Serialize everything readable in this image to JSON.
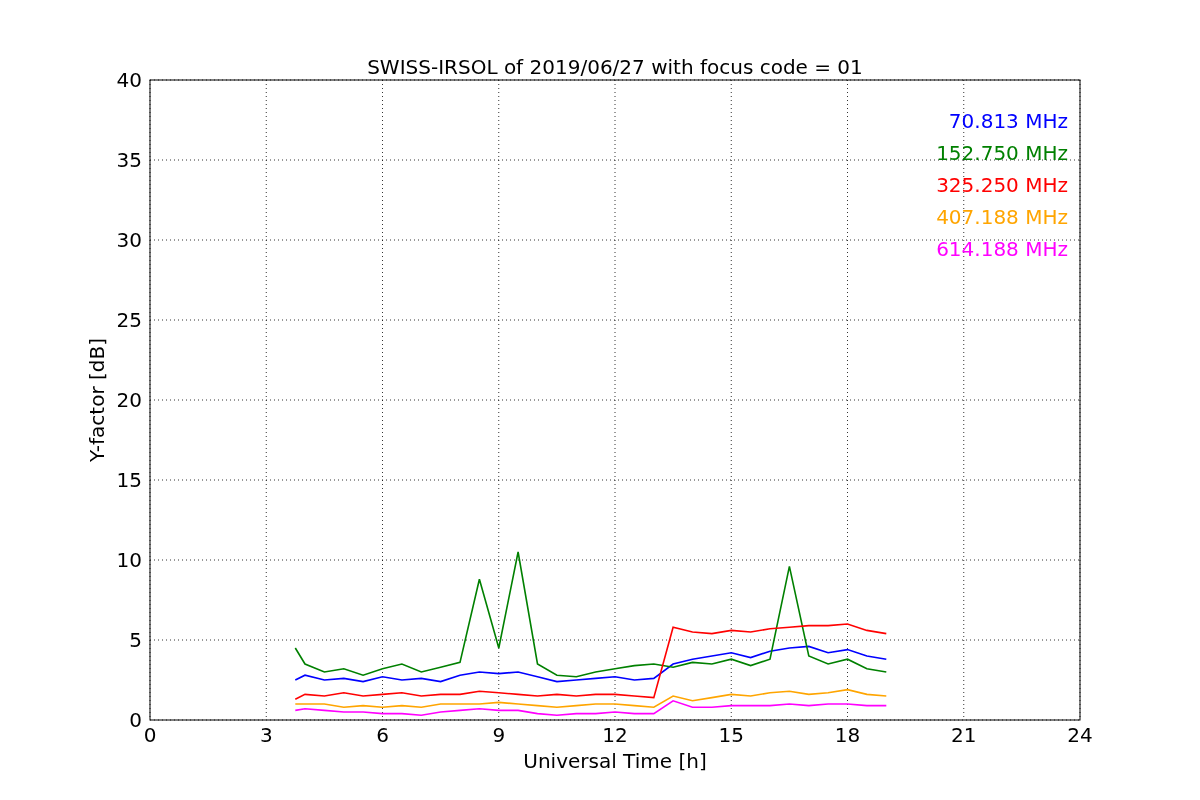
{
  "chart_data": {
    "type": "line",
    "title": "SWISS-IRSOL of 2019/06/27 with focus code = 01",
    "xlabel": "Universal Time [h]",
    "ylabel": "Y-factor [dB]",
    "x": [
      3.75,
      4,
      4.5,
      5,
      5.5,
      6,
      6.5,
      7,
      7.5,
      8,
      8.5,
      9,
      9.5,
      10,
      10.5,
      11,
      11.5,
      12,
      12.5,
      13,
      13.5,
      14,
      14.5,
      15,
      15.5,
      16,
      16.5,
      17,
      17.5,
      18,
      18.5,
      19
    ],
    "series": [
      {
        "name": "70.813 MHz",
        "color": "#0000ff",
        "values": [
          2.5,
          2.8,
          2.5,
          2.6,
          2.4,
          2.7,
          2.5,
          2.6,
          2.4,
          2.8,
          3,
          2.9,
          3,
          2.7,
          2.4,
          2.5,
          2.6,
          2.7,
          2.5,
          2.6,
          3.5,
          3.8,
          4,
          4.2,
          3.9,
          4.3,
          4.5,
          4.6,
          4.2,
          4.4,
          4,
          3.8
        ]
      },
      {
        "name": "152.750 MHz",
        "color": "#008000",
        "values": [
          4.5,
          3.5,
          3,
          3.2,
          2.8,
          3.2,
          3.5,
          3,
          3.3,
          3.6,
          8.8,
          4.5,
          10.5,
          3.5,
          2.8,
          2.7,
          3,
          3.2,
          3.4,
          3.5,
          3.3,
          3.6,
          3.5,
          3.8,
          3.4,
          3.8,
          9.6,
          4,
          3.5,
          3.8,
          3.2,
          3
        ]
      },
      {
        "name": "325.250 MHz",
        "color": "#ff0000",
        "values": [
          1.3,
          1.6,
          1.5,
          1.7,
          1.5,
          1.6,
          1.7,
          1.5,
          1.6,
          1.6,
          1.8,
          1.7,
          1.6,
          1.5,
          1.6,
          1.5,
          1.6,
          1.6,
          1.5,
          1.4,
          5.8,
          5.5,
          5.4,
          5.6,
          5.5,
          5.7,
          5.8,
          5.9,
          5.9,
          6,
          5.6,
          5.4
        ]
      },
      {
        "name": "407.188 MHz",
        "color": "#ffa500",
        "values": [
          1,
          1,
          1,
          0.8,
          0.9,
          0.8,
          0.9,
          0.8,
          1,
          1,
          1,
          1.1,
          1,
          0.9,
          0.8,
          0.9,
          1,
          1,
          0.9,
          0.8,
          1.5,
          1.2,
          1.4,
          1.6,
          1.5,
          1.7,
          1.8,
          1.6,
          1.7,
          1.9,
          1.6,
          1.5
        ]
      },
      {
        "name": "614.188 MHz",
        "color": "#ff00ff",
        "values": [
          0.6,
          0.7,
          0.6,
          0.5,
          0.5,
          0.4,
          0.4,
          0.3,
          0.5,
          0.6,
          0.7,
          0.6,
          0.6,
          0.4,
          0.3,
          0.4,
          0.4,
          0.5,
          0.4,
          0.4,
          1.2,
          0.8,
          0.8,
          0.9,
          0.9,
          0.9,
          1,
          0.9,
          1,
          1,
          0.9,
          0.9
        ]
      }
    ],
    "grid": true,
    "xlim": [
      0,
      24
    ],
    "ylim": [
      0,
      40
    ],
    "xticks": [
      0,
      3,
      6,
      9,
      12,
      15,
      18,
      21,
      24
    ],
    "yticks": [
      0,
      5,
      10,
      15,
      20,
      25,
      30,
      35,
      40
    ]
  }
}
